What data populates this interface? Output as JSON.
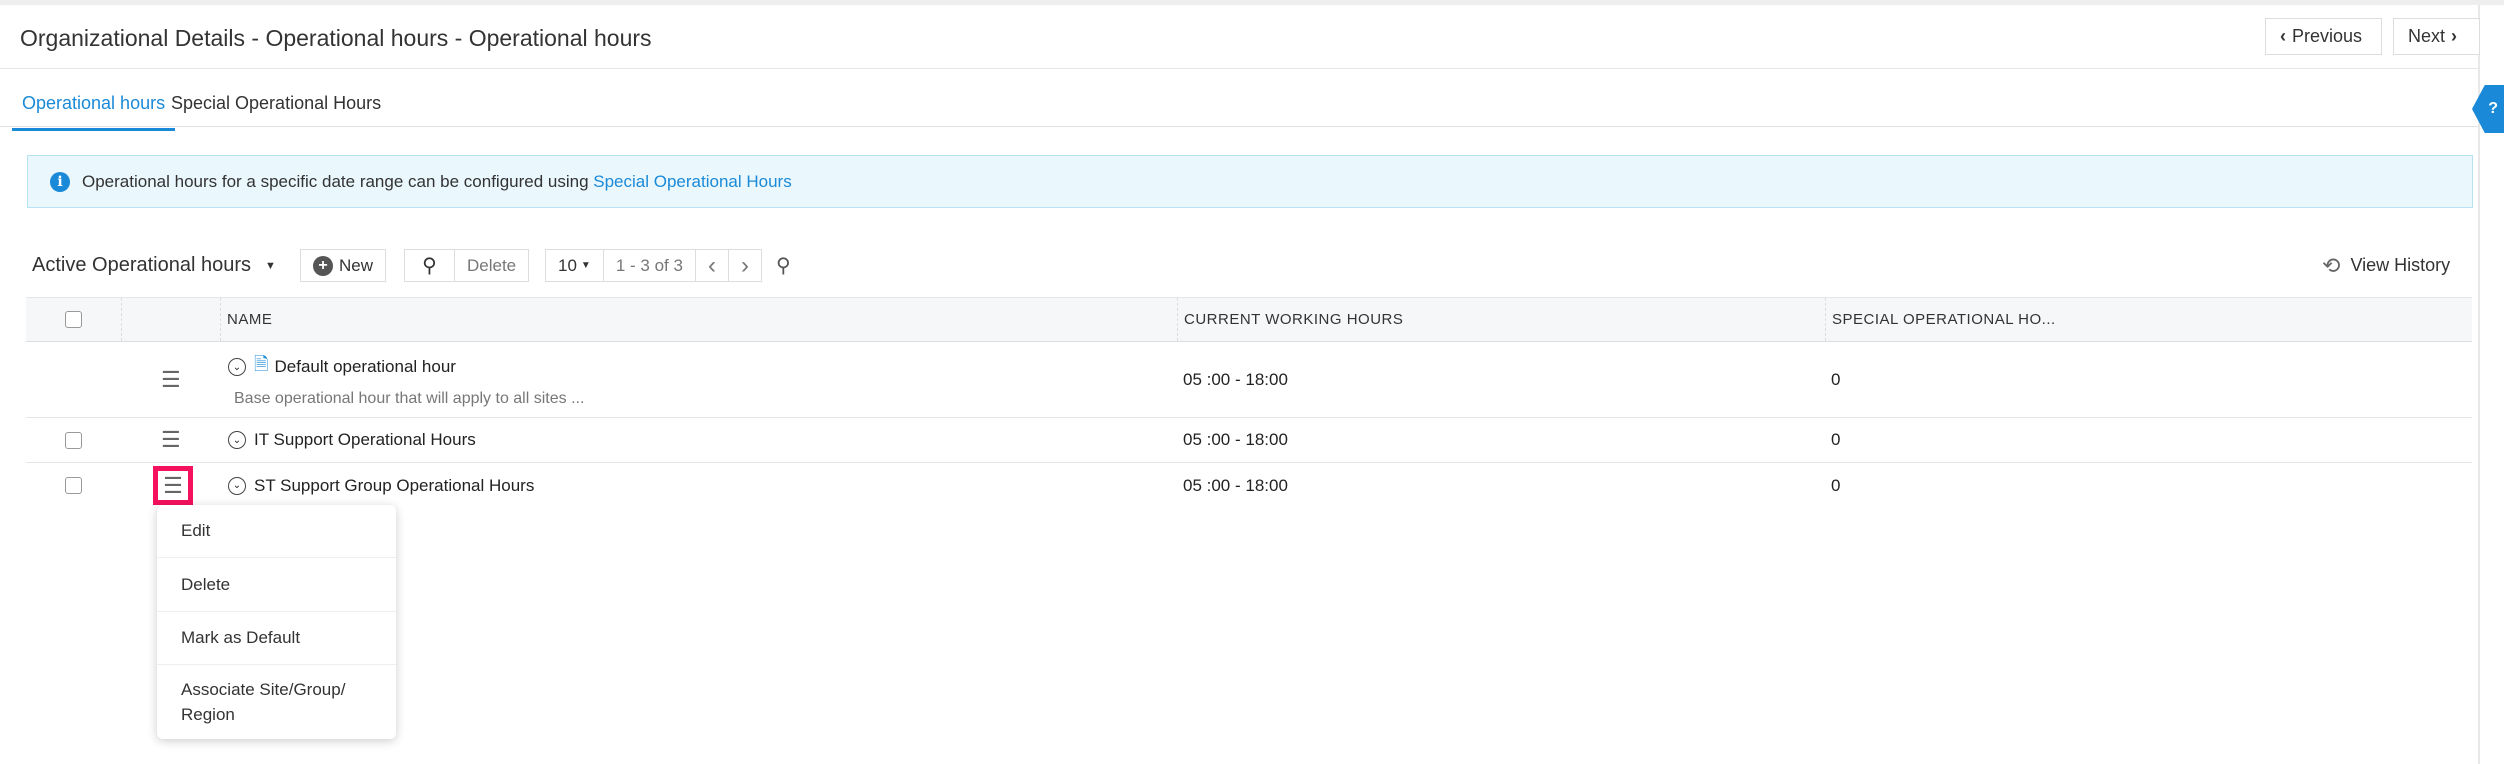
{
  "header": {
    "title": "Organizational Details - Operational hours - Operational hours",
    "previous_label": "Previous",
    "next_label": "Next"
  },
  "tabs": [
    {
      "label": "Operational hours",
      "active": true
    },
    {
      "label": "Special Operational Hours",
      "active": false
    }
  ],
  "help_label": "?",
  "banner": {
    "text": "Operational hours for a specific date range can be configured using ",
    "link": "Special Operational Hours"
  },
  "toolbar": {
    "view_label": "Active Operational hours",
    "new_label": "New",
    "delete_label": "Delete",
    "page_size": "10",
    "range": "1 - 3 of 3",
    "view_history_label": "View History"
  },
  "table": {
    "columns": [
      "NAME",
      "CURRENT WORKING HOURS",
      "SPECIAL OPERATIONAL HO..."
    ],
    "rows": [
      {
        "name": "Default operational hour",
        "description": "Base operational hour that will apply to all sites ...",
        "hours": "05 :00 - 18:00",
        "special": "0"
      },
      {
        "name": "IT Support Operational Hours",
        "hours": "05 :00 - 18:00",
        "special": "0"
      },
      {
        "name": "ST Support Group Operational Hours",
        "hours": "05 :00 - 18:00",
        "special": "0"
      }
    ]
  },
  "context_menu": {
    "items": [
      "Edit",
      "Delete",
      "Mark as Default",
      "Associate Site/Group/ Region"
    ]
  },
  "colors": {
    "accent": "#1a8ad8",
    "highlight": "#f5115d"
  }
}
